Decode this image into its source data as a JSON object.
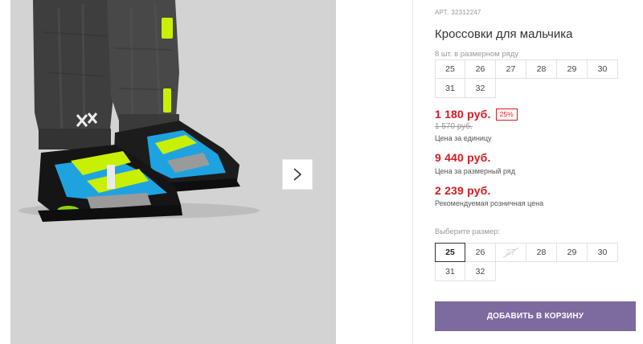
{
  "product": {
    "article_label": "АРТ.",
    "article_number": "32312247",
    "title": "Кроссовки для мальчика"
  },
  "pack": {
    "note": "8 шт. в размерном ряду",
    "sizes": [
      "25",
      "26",
      "27",
      "28",
      "29",
      "30",
      "31",
      "32"
    ]
  },
  "prices": {
    "unit_price": "1 180 руб.",
    "discount": "25%",
    "old_price": "1 570 руб.",
    "unit_label": "Цена за единицу",
    "pack_price": "9 440 руб.",
    "pack_label": "Цена за размерный ряд",
    "rrp_price": "2 239 руб.",
    "rrp_label": "Рекомендуемая розничная цена"
  },
  "size_picker": {
    "label": "Выберите размер:",
    "sizes": [
      "25",
      "26",
      "27",
      "28",
      "29",
      "30",
      "31",
      "32"
    ],
    "selected": "25",
    "unavailable": [
      "27"
    ]
  },
  "cart_button": {
    "label": "ДОБАВИТЬ В КОРЗИНУ"
  },
  "gallery": {
    "next_icon": "chevron-right-icon"
  },
  "colors": {
    "price_red": "#d7191f",
    "button_purple": "#7d6a9e",
    "shoe_blue": "#1fa3e0",
    "shoe_lime": "#c8f000"
  }
}
